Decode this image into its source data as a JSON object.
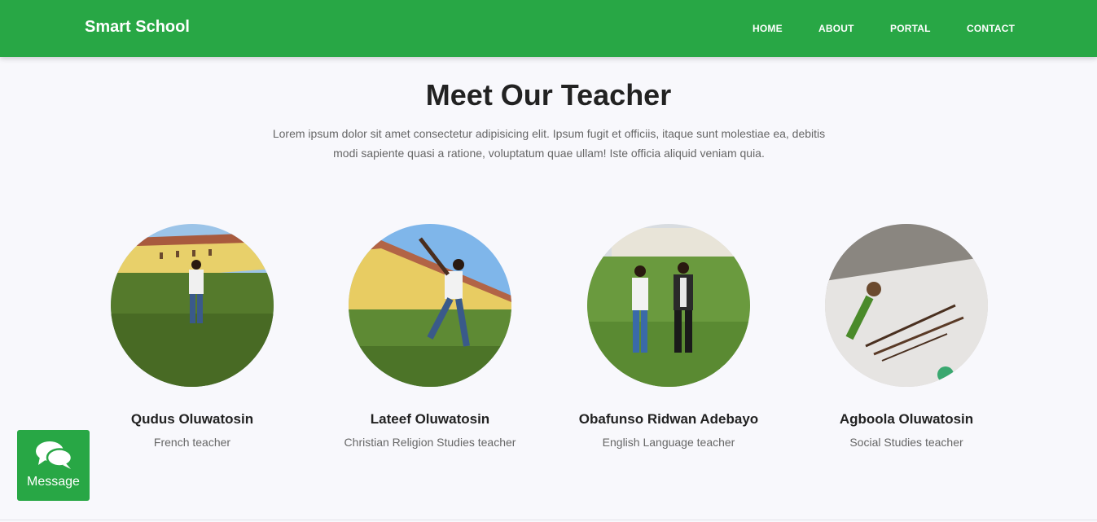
{
  "navbar": {
    "brand": "Smart School",
    "links": [
      "HOME",
      "ABOUT",
      "PORTAL",
      "CONTACT"
    ],
    "bg_color": "#28a745"
  },
  "section": {
    "title": "Meet Our Teacher",
    "description": "Lorem ipsum dolor sit amet consectetur adipisicing elit. Ipsum fugit et officiis, itaque sunt molestiae ea, debitis modi sapiente quasi a ratione, voluptatum quae ullam! Iste officia aliquid veniam quia."
  },
  "teachers": [
    {
      "name": "Qudus Oluwatosin",
      "role": "French teacher"
    },
    {
      "name": "Lateef Oluwatosin",
      "role": "Christian Religion Studies teacher"
    },
    {
      "name": "Obafunso Ridwan Adebayo",
      "role": "English Language teacher"
    },
    {
      "name": "Agboola Oluwatosin",
      "role": "Social Studies teacher"
    }
  ],
  "message_widget": {
    "label": "Message",
    "icon": "chat-bubbles-icon"
  }
}
